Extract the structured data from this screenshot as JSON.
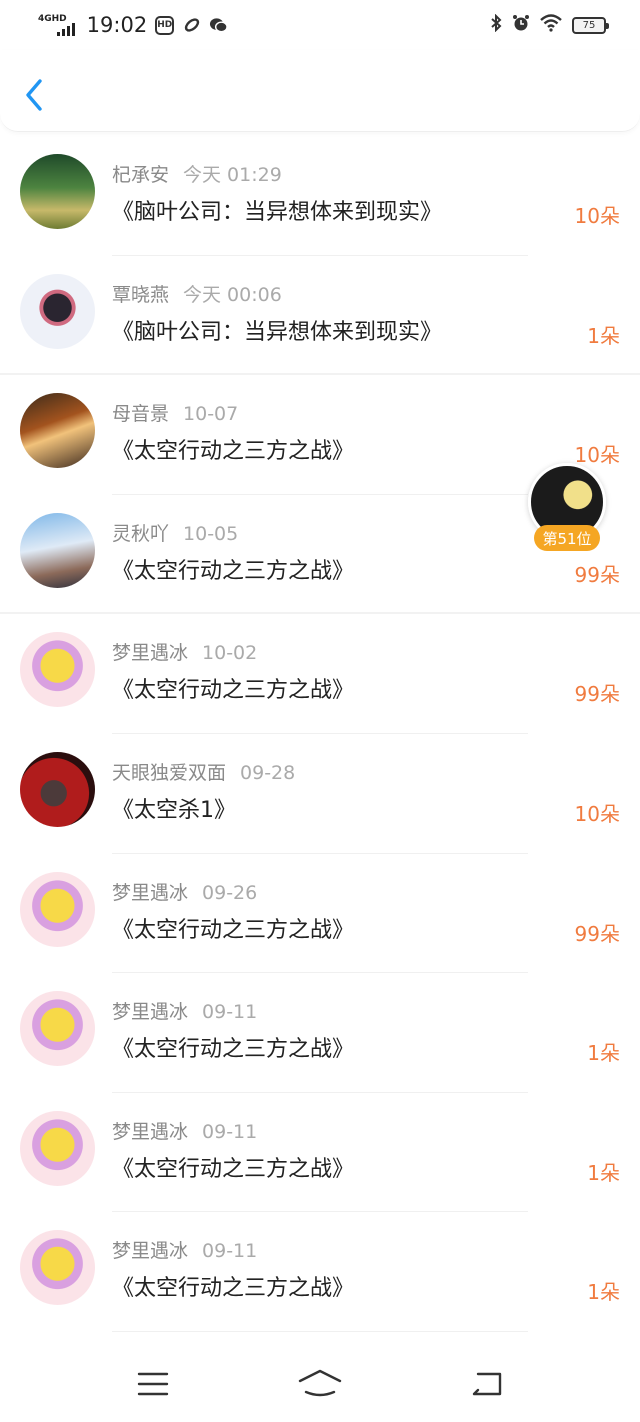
{
  "status_bar": {
    "network": "4GHD",
    "time": "19:02",
    "battery": "75",
    "icons": [
      "signal-icon",
      "hd-app-icon",
      "link-app-icon",
      "wechat-icon",
      "bluetooth-icon",
      "alarm-icon",
      "wifi-icon",
      "battery-icon"
    ]
  },
  "header": {
    "back_icon": "chevron-left-icon"
  },
  "colors": {
    "accent_blue": "#2196f3",
    "flower_orange": "#f07b3f",
    "rank_badge": "#f5a623"
  },
  "rank": {
    "label": "第51位"
  },
  "records": [
    {
      "name": "杞承安",
      "date": "今天 01:29",
      "title": "《脑叶公司：当异想体来到现实》",
      "flowers": "10朵"
    },
    {
      "name": "覃晓燕",
      "date": "今天 00:06",
      "title": "《脑叶公司：当异想体来到现实》",
      "flowers": "1朵"
    },
    {
      "name": "母音景",
      "date": "10-07",
      "title": "《太空行动之三方之战》",
      "flowers": "10朵"
    },
    {
      "name": "灵秋吖",
      "date": "10-05",
      "title": "《太空行动之三方之战》",
      "flowers": "99朵"
    },
    {
      "name": "梦里遇冰",
      "date": "10-02",
      "title": "《太空行动之三方之战》",
      "flowers": "99朵"
    },
    {
      "name": "天眼独爱双面",
      "date": "09-28",
      "title": "《太空杀1》",
      "flowers": "10朵"
    },
    {
      "name": "梦里遇冰",
      "date": "09-26",
      "title": "《太空行动之三方之战》",
      "flowers": "99朵"
    },
    {
      "name": "梦里遇冰",
      "date": "09-11",
      "title": "《太空行动之三方之战》",
      "flowers": "1朵"
    },
    {
      "name": "梦里遇冰",
      "date": "09-11",
      "title": "《太空行动之三方之战》",
      "flowers": "1朵"
    },
    {
      "name": "梦里遇冰",
      "date": "09-11",
      "title": "《太空行动之三方之战》",
      "flowers": "1朵"
    }
  ],
  "nav_bar": {
    "icons": [
      "menu-icon",
      "home-icon",
      "back-icon"
    ]
  }
}
